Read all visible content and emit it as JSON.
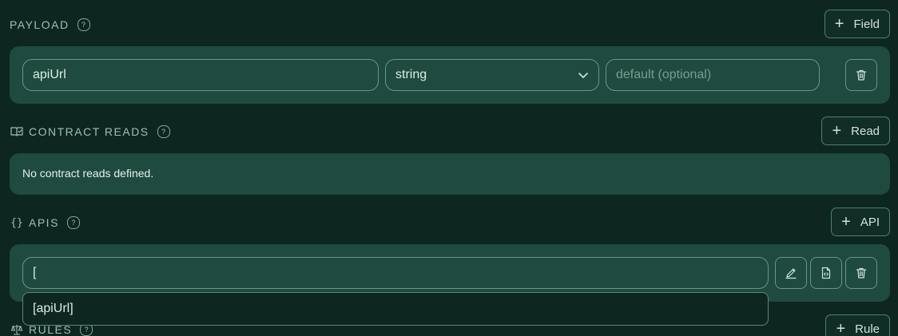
{
  "payload": {
    "title": "PAYLOAD",
    "help": "?",
    "add_label": "Field",
    "fields": [
      {
        "name_value": "apiUrl",
        "type_value": "string",
        "default_placeholder": "default (optional)"
      }
    ]
  },
  "contract_reads": {
    "title": "CONTRACT READS",
    "help": "?",
    "add_label": "Read",
    "empty_message": "No contract reads defined."
  },
  "apis": {
    "title": "APIS",
    "icon_text": "{}",
    "help": "?",
    "add_label": "API",
    "input_value": "[",
    "suggestion": "[apiUrl]"
  },
  "rules": {
    "title": "RULES",
    "help": "?",
    "add_label": "Rule"
  },
  "colors": {
    "background": "#0e2620",
    "panel": "#1e4a3f",
    "border": "#6a9688",
    "text": "#cfe3dc"
  }
}
